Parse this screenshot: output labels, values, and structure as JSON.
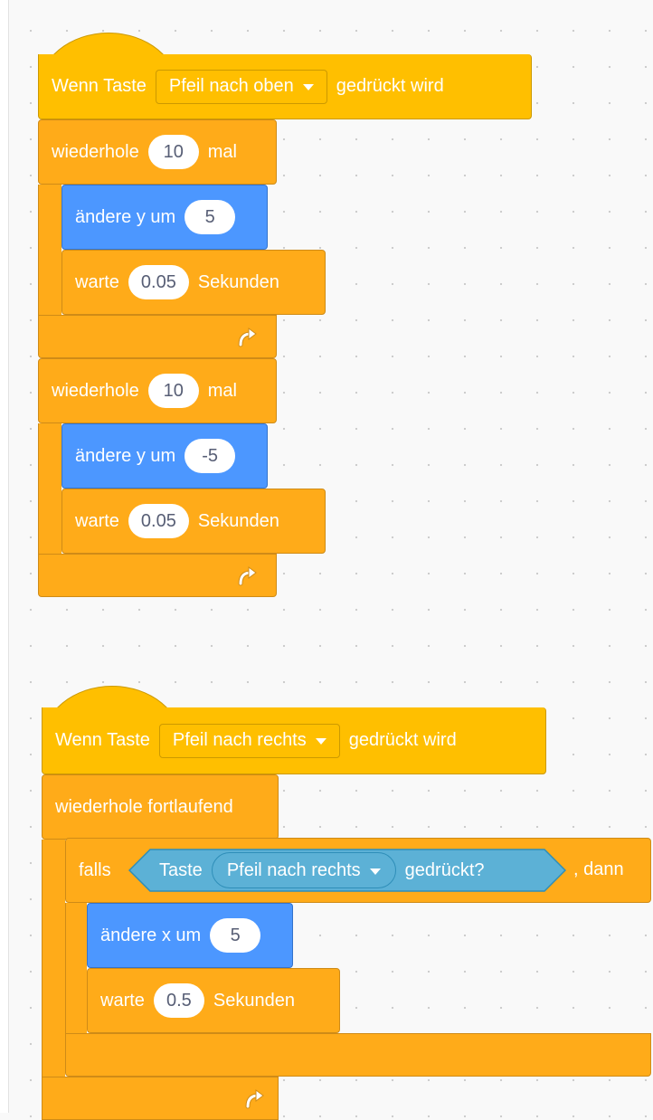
{
  "script1": {
    "hat": {
      "prefix": "Wenn Taste",
      "key": "Pfeil nach oben",
      "suffix": "gedrückt wird"
    },
    "loop1": {
      "label": "wiederhole",
      "count": "10",
      "unit": "mal",
      "change": {
        "label": "ändere y um",
        "value": "5"
      },
      "wait": {
        "label": "warte",
        "value": "0.05",
        "unit": "Sekunden"
      }
    },
    "loop2": {
      "label": "wiederhole",
      "count": "10",
      "unit": "mal",
      "change": {
        "label": "ändere y um",
        "value": "-5"
      },
      "wait": {
        "label": "warte",
        "value": "0.05",
        "unit": "Sekunden"
      }
    }
  },
  "script2": {
    "hat": {
      "prefix": "Wenn Taste",
      "key": "Pfeil nach rechts",
      "suffix": "gedrückt wird"
    },
    "forever": {
      "label": "wiederhole fortlaufend"
    },
    "if": {
      "label": "falls",
      "then": ", dann",
      "sensor": {
        "prefix": "Taste",
        "key": "Pfeil nach rechts",
        "suffix": "gedrückt?"
      }
    },
    "change": {
      "label": "ändere x um",
      "value": "5"
    },
    "wait": {
      "label": "warte",
      "value": "0.5",
      "unit": "Sekunden"
    }
  },
  "colors": {
    "events": "#ffbf00",
    "control": "#ffab19",
    "motion": "#4c97ff",
    "sensing": "#5cb1d6",
    "background": "#f9f9f9"
  },
  "icons": {
    "loop_arrow": "loop-arrow-icon",
    "dropdown": "caret-down-icon"
  }
}
